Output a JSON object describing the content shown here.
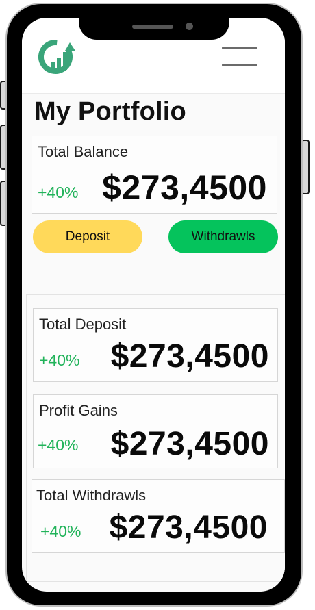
{
  "page": {
    "title": "My Portfolio"
  },
  "header": {
    "logo_icon": "growth-logo-icon",
    "menu_icon": "hamburger-menu-icon"
  },
  "colors": {
    "accent_green": "#21b35a",
    "deposit_yellow": "#ffd95a",
    "withdraw_green": "#05c35c",
    "logo_green": "#3aa57a"
  },
  "balance": {
    "label": "Total Balance",
    "change": "+40%",
    "amount": "$273,4500"
  },
  "actions": {
    "deposit_label": "Deposit",
    "withdraw_label": "Withdrawls"
  },
  "stats": [
    {
      "label": "Total Deposit",
      "change": "+40%",
      "amount": "$273,4500"
    },
    {
      "label": "Profit Gains",
      "change": "+40%",
      "amount": "$273,4500"
    },
    {
      "label": "Total Withdrawls",
      "change": "+40%",
      "amount": "$273,4500"
    }
  ]
}
